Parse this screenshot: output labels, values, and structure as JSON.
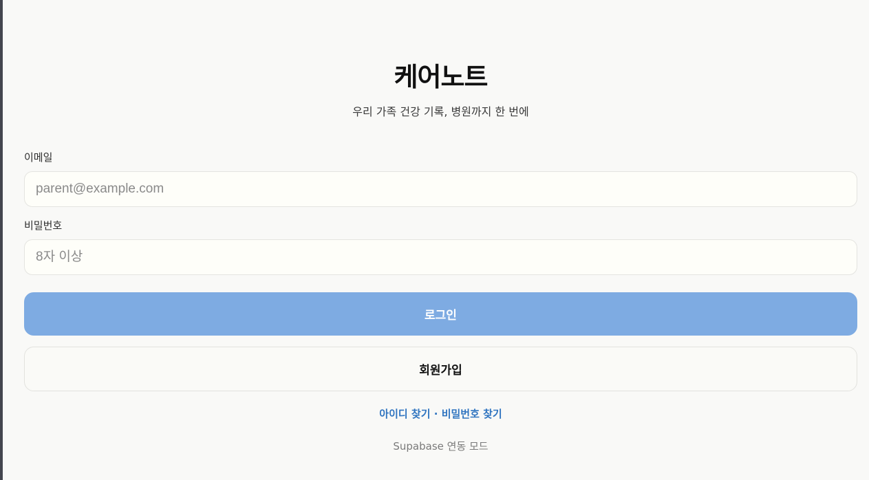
{
  "app": {
    "title": "케어노트",
    "subtitle": "우리 가족 건강 기록, 병원까지 한 번에"
  },
  "form": {
    "email": {
      "label": "이메일",
      "placeholder": "parent@example.com",
      "value": ""
    },
    "password": {
      "label": "비밀번호",
      "placeholder": "8자 이상",
      "value": ""
    },
    "login_label": "로그인",
    "signup_label": "회원가입"
  },
  "links": {
    "find_id": "아이디 찾기",
    "separator": "·",
    "find_password": "비밀번호 찾기"
  },
  "footer": {
    "mode_text": "Supabase 연동 모드"
  },
  "colors": {
    "background": "#f9f9f7",
    "primary_button": "#7eabe2",
    "link": "#2f74c0",
    "input_background": "#fefef9"
  }
}
